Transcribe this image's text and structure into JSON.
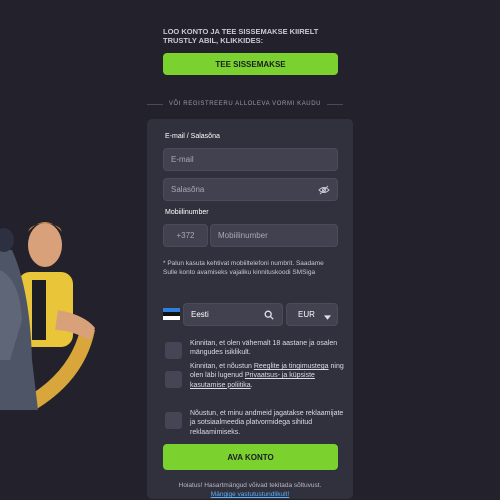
{
  "intro": {
    "text": "LOO KONTO JA TEE SISSEMAKSE KIIRELT TRUSTLY ABIL, KLIKKIDES:",
    "deposit_button": "TEE SISSEMAKSE"
  },
  "divider_text": "VÕI REGISTREERU ALLOLEVA VORMI KAUDU",
  "form": {
    "email_password_label": "E-mail / Salasõna",
    "email_placeholder": "E-mail",
    "password_placeholder": "Salasõna",
    "mobile_label": "Mobiilinumber",
    "phone_prefix": "+372",
    "mobile_placeholder": "Mobiilinumber",
    "phone_hint": "* Palun kasuta kehtivat mobiiltelefoni numbrit. Saadame Sulle konto avamiseks vajaliku kinnituskoodi SMSiga",
    "country_value": "Eesti",
    "currency_value": "EUR",
    "checks": [
      {
        "text": "Kinnitan, et olen vähemalt 18 aastane ja osalen mängudes isiklikult."
      },
      {
        "pre": "Kinnitan, et nõustun ",
        "link1": "Reeglite ja tingimustega",
        "mid": " ning olen läbi lugenud ",
        "link2": "Privaatsus- ja küpsiste kasutamise poliitika",
        "post": "."
      },
      {
        "text": "Nõustun, et minu andmeid jagatakse reklaamijate ja sotsiaalmeedia platvormidega sihitud reklaamimiseks."
      }
    ],
    "create_button": "AVA KONTO",
    "warning_text": "Hoiatus! Hasartmängud võivad tekitada sõltuvust.",
    "warning_link": "Mängige vastutustundlikult!"
  },
  "colors": {
    "accent": "#7bd12e",
    "background": "#22212c",
    "card": "#31313e",
    "link": "#5aaefb"
  },
  "icons": [
    "eye-slash-icon",
    "search-icon",
    "caret-down-icon",
    "estonia-flag-icon"
  ]
}
